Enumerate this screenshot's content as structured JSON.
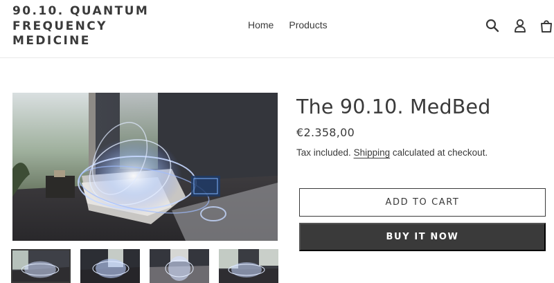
{
  "header": {
    "logo_text": "90.10. QUANTUM FREQUENCY MEDICINE",
    "nav": [
      {
        "label": "Home"
      },
      {
        "label": "Products"
      }
    ],
    "icons": [
      "search-icon",
      "account-icon",
      "cart-icon"
    ]
  },
  "product": {
    "title": "The 90.10. MedBed",
    "price": "€2.358,00",
    "tax_prefix": "Tax included. ",
    "tax_link": "Shipping",
    "tax_suffix": " calculated at checkout.",
    "add_to_cart": "ADD TO CART",
    "buy_now": "BUY IT NOW",
    "images": {
      "main": "medbed-room-photo",
      "thumbnails": [
        "thumb-1",
        "thumb-2",
        "thumb-3",
        "thumb-4"
      ],
      "active_thumbnail": 0
    }
  },
  "colors": {
    "text": "#3a3a3a",
    "button_dark": "#3a3a3a",
    "background": "#ffffff",
    "divider": "#e8e8e8"
  }
}
